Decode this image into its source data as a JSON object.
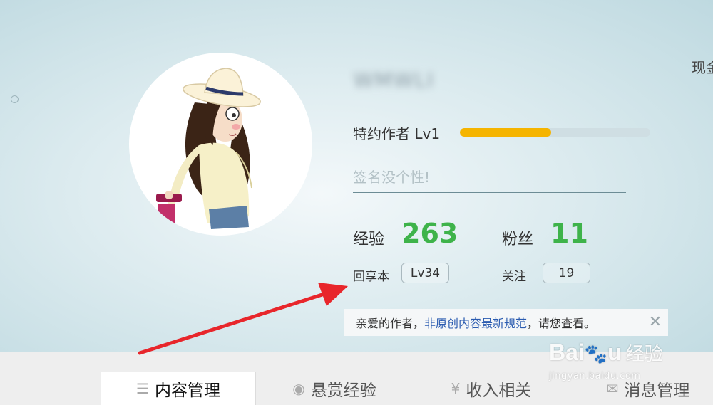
{
  "profile": {
    "username": "WMWLI",
    "level_label": "特约作者 Lv1",
    "level_progress": 0.48,
    "signature_placeholder": "签名没个性!",
    "experience_label": "经验",
    "experience_value": "263",
    "fans_label": "粉丝",
    "fans_value": "11",
    "huixiangben_label": "回享本",
    "huixiangben_level": "Lv34",
    "follow_label": "关注",
    "follow_count": "19"
  },
  "top_right_text": "现金",
  "notice": {
    "prefix": "亲爱的作者，",
    "link": "非原创内容最新规范",
    "suffix": "，请您查看。",
    "close_icon": "close-icon"
  },
  "tabs": [
    {
      "label": "内容管理",
      "icon": "list-icon",
      "active": true
    },
    {
      "label": "悬赏经验",
      "icon": "reward-icon",
      "active": false
    },
    {
      "label": "收入相关",
      "icon": "yen-icon",
      "active": false
    },
    {
      "label": "消息管理",
      "icon": "mail-icon",
      "active": false
    }
  ],
  "watermark": {
    "brand": "Bai",
    "brand_suffix": "u",
    "cn": "经验",
    "url": "jingyan.baidu.com"
  },
  "colors": {
    "accent_green": "#3eb34a",
    "progress_fill": "#f5b400",
    "link_blue": "#2a5bb0",
    "arrow_red": "#e8262b"
  }
}
